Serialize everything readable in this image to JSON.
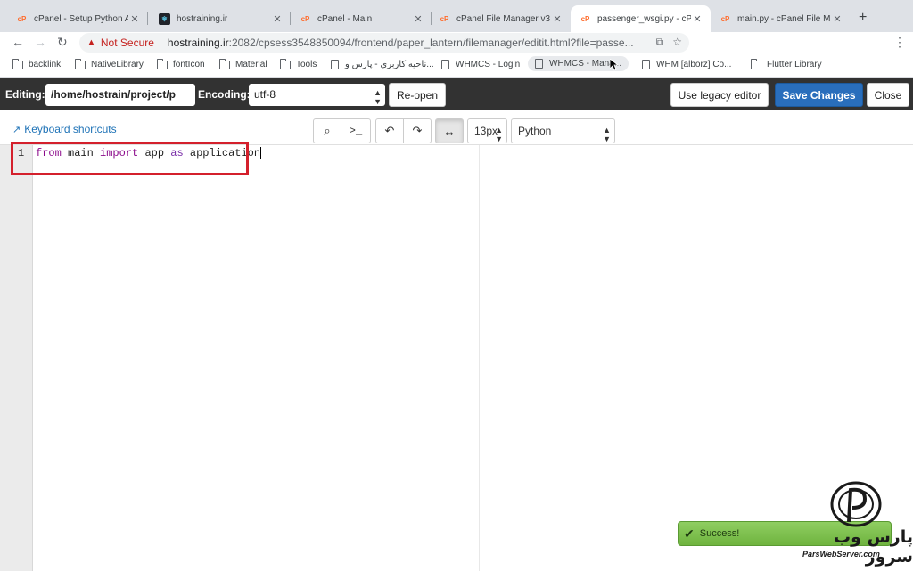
{
  "browser": {
    "tabs": [
      {
        "title": "cPanel - Setup Python A",
        "icon": "cpanel-icon"
      },
      {
        "title": "hostraining.ir",
        "icon": "react-icon"
      },
      {
        "title": "cPanel - Main",
        "icon": "cpanel-icon"
      },
      {
        "title": "cPanel File Manager v3",
        "icon": "cpanel-icon"
      },
      {
        "title": "passenger_wsgi.py - cP",
        "icon": "cpanel-icon",
        "active": true
      },
      {
        "title": "main.py - cPanel File M",
        "icon": "cpanel-icon"
      }
    ],
    "new_tab": "+",
    "address": {
      "security_label": "Not Secure",
      "host": "hostraining.ir",
      "rest": ":2082/cpsess3548850094/frontend/paper_lantern/filemanager/editit.html?file=passe..."
    },
    "bookmarks": [
      {
        "label": "backlink",
        "type": "folder"
      },
      {
        "label": "NativeLibrary",
        "type": "folder"
      },
      {
        "label": "fontIcon",
        "type": "folder"
      },
      {
        "label": "Material",
        "type": "folder"
      },
      {
        "label": "Tools",
        "type": "folder"
      },
      {
        "label": "ناحیه کاربری - پارس و...",
        "type": "page"
      },
      {
        "label": "WHMCS - Login",
        "type": "page"
      },
      {
        "label": "WHMCS - Mana...",
        "type": "page"
      },
      {
        "label": "WHM [alborz] Co...",
        "type": "page"
      },
      {
        "label": "Flutter Library",
        "type": "folder"
      }
    ]
  },
  "editor_header": {
    "editing_label": "Editing:",
    "path_value": "/home/hostrain/project/p",
    "encoding_label": "Encoding:",
    "encoding_value": "utf-8",
    "reopen_label": "Re-open",
    "legacy_label": "Use legacy editor",
    "save_label": "Save Changes",
    "close_label": "Close"
  },
  "toolbar": {
    "keyboard_shortcuts": "Keyboard shortcuts",
    "font_size": "13px",
    "language": "Python"
  },
  "code": {
    "line_number": "1",
    "tokens": [
      "from",
      " main ",
      "import",
      " app ",
      "as",
      " application"
    ]
  },
  "toast": {
    "message": "Success!"
  },
  "watermark": {
    "text": "پارس وب سرور",
    "sub": "ParsWebServer.com"
  },
  "colors": {
    "header_bg": "#323232",
    "save_button": "#296ebc",
    "highlight_box": "#d4202c",
    "keyword": "#8b0a8b",
    "toast_bg": "#7bbd4c"
  }
}
